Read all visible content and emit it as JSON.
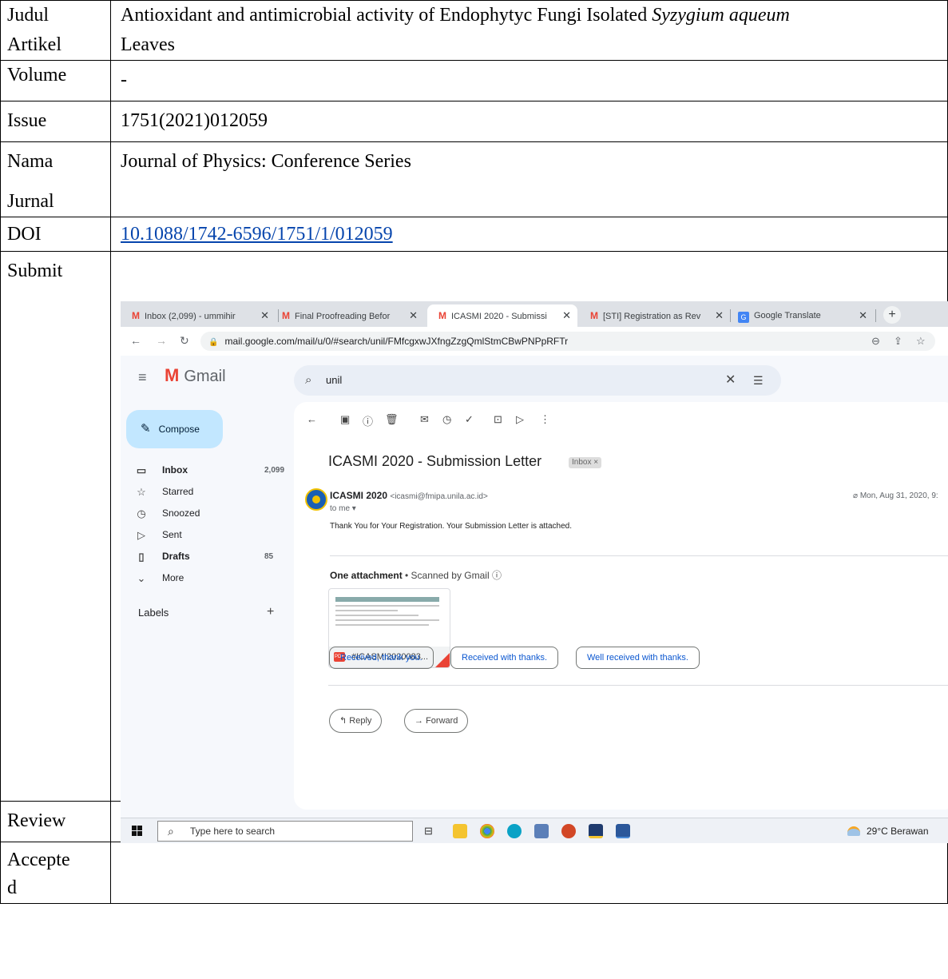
{
  "table": {
    "judul_label_1": "Judul",
    "judul_label_2": "Artikel",
    "judul_value_a": "Antioxidant and antimicrobial activity of Endophytyc Fungi Isolated ",
    "judul_value_italic": "Syzygium aqueum",
    "judul_value_b": "Leaves",
    "volume_label": "Volume",
    "volume_value": "-",
    "issue_label": "Issue",
    "issue_value": "1751(2021)012059",
    "nama_label_1": "Nama",
    "nama_label_2": "Jurnal",
    "nama_value": "Journal of Physics: Conference Series",
    "doi_label": "DOI",
    "doi_value": "10.1088/1742-6596/1751/1/012059",
    "submit_label": "Submit",
    "review_label": "Review",
    "review_value": "",
    "accepted_label_1": "Accepte",
    "accepted_label_2": "d",
    "accepted_value": ""
  },
  "browser": {
    "tabs": [
      {
        "label": "Inbox (2,099) - ummihir"
      },
      {
        "label": "Final Proofreading Befor"
      },
      {
        "label": "ICASMI 2020 - Submissi"
      },
      {
        "label": "[STI] Registration as Rev"
      },
      {
        "label": "Google Translate"
      }
    ],
    "url": "mail.google.com/mail/u/0/#search/unil/FMfcgxwJXfngZzgQmlStmCBwPNPpRFTr"
  },
  "gmail": {
    "brand": "Gmail",
    "search_query": "unil",
    "compose_label": "Compose",
    "nav": [
      {
        "label": "Inbox",
        "count": "2,099"
      },
      {
        "label": "Starred",
        "count": ""
      },
      {
        "label": "Snoozed",
        "count": ""
      },
      {
        "label": "Sent",
        "count": ""
      },
      {
        "label": "Drafts",
        "count": "85"
      },
      {
        "label": "More",
        "count": ""
      }
    ],
    "labels_heading": "Labels",
    "subject": "ICASMI 2020 - Submission Letter",
    "badge": "Inbox ×",
    "sender_name": "ICASMI 2020",
    "sender_email": "<icasmi@fmipa.unila.ac.id>",
    "to_me": "to me ▾",
    "date": "Mon, Aug 31, 2020, 9:",
    "message": "Thank You for Your Registration. Your Submission Letter is attached.",
    "attachment_title": "One attachment",
    "attachment_scan": " • Scanned by Gmail ⓘ",
    "attachment_name": "#ICASMI2020083...",
    "smart_replies": [
      "Received, thank you.",
      "Received with thanks.",
      "Well received with thanks."
    ],
    "reply_label": "Reply",
    "forward_label": "Forward"
  },
  "taskbar": {
    "search_placeholder": "Type here to search",
    "weather": "29°C Berawan"
  }
}
